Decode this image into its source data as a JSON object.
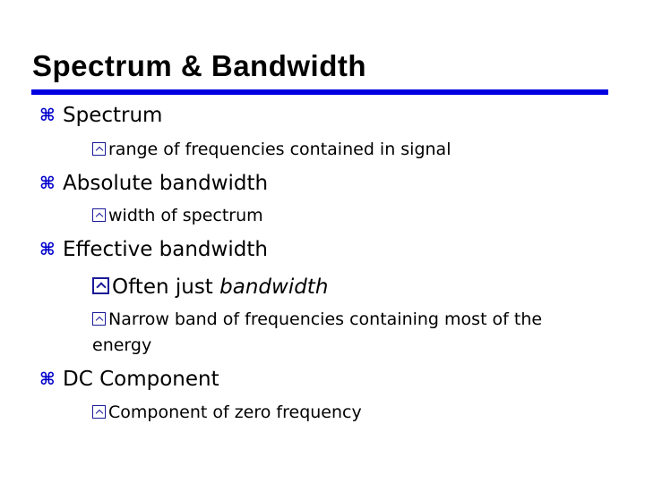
{
  "slide": {
    "title": "Spectrum & Bandwidth",
    "accent_color": "#0000e0",
    "bullet_color": "#0000cc",
    "items": [
      {
        "text": "Spectrum",
        "icon": "command-key-bullet",
        "sub": [
          {
            "text": "range of frequencies contained in signal"
          }
        ]
      },
      {
        "text": "Absolute bandwidth",
        "icon": "command-key-bullet",
        "sub": [
          {
            "text": "width of spectrum"
          }
        ]
      },
      {
        "text": "Effective bandwidth",
        "icon": "command-key-bullet",
        "sub": [
          {
            "text": "Often just ",
            "emph": "bandwidth"
          },
          {
            "text": "Narrow band of frequencies containing most of the",
            "cont": "energy"
          }
        ]
      },
      {
        "text": "DC Component",
        "icon": "command-key-bullet",
        "sub": [
          {
            "text": "Component of zero frequency"
          }
        ]
      }
    ]
  }
}
